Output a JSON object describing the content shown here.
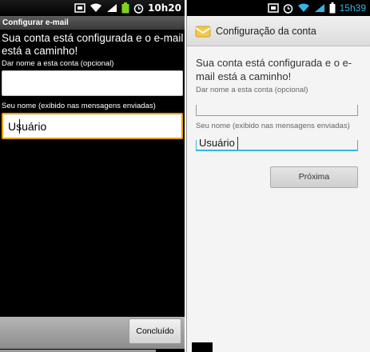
{
  "left": {
    "status": {
      "time": "10h20"
    },
    "title": "Configurar e-mail",
    "headline": "Sua conta está configurada e o e-mail está a caminho!",
    "account_name_label": "Dar nome a esta conta (opcional)",
    "account_name_value": "",
    "your_name_label": "Seu nome (exibido nas mensagens enviadas)",
    "your_name_value": "Usuário",
    "done_button": "Concluído"
  },
  "right": {
    "status": {
      "time": "15h39"
    },
    "title": "Configuração da conta",
    "headline": "Sua conta está configurada e o e-mail está a caminho!",
    "account_name_label": "Dar nome a esta conta (opcional)",
    "account_name_value": "",
    "your_name_label": "Seu nome (exibido nas mensagens enviadas)",
    "your_name_value": "Usuário",
    "next_button": "Próxima"
  },
  "colors": {
    "holo_blue": "#33b5e5",
    "battery_green": "#7ed321"
  },
  "icons": [
    "signal-icon",
    "wifi-icon",
    "battery-icon",
    "alarm-icon",
    "screenshot-icon",
    "email-envelope-icon"
  ]
}
